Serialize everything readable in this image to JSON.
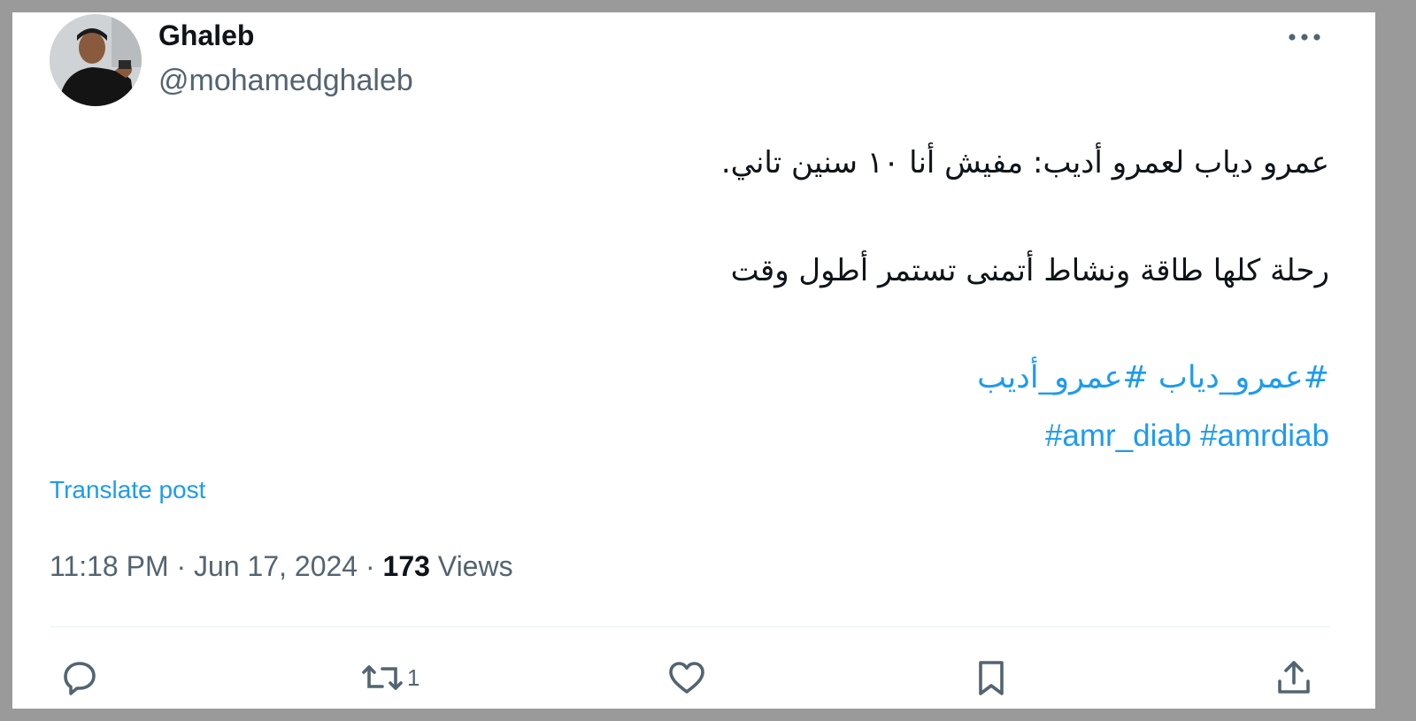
{
  "author": {
    "name": "Ghaleb",
    "handle": "@mohamedghaleb"
  },
  "post": {
    "line1": "عمرو دياب لعمرو أديب: مفيش أنا ١٠ سنين تاني.",
    "line2": "رحلة كلها طاقة ونشاط أتمنى تستمر أطول وقت",
    "hashtags_arabic": [
      "#عمرو_دياب",
      "#عمرو_أديب"
    ],
    "hashtags_latin": [
      "#amr_diab",
      "#amrdiab"
    ]
  },
  "translate_label": "Translate post",
  "meta": {
    "time": "11:18 PM",
    "separator": "·",
    "date": "Jun 17, 2024",
    "views_count": "173",
    "views_label": "Views"
  },
  "actions": {
    "retweet_count": "1"
  },
  "icons": [
    "more-icon",
    "reply-icon",
    "retweet-icon",
    "like-icon",
    "bookmark-icon",
    "share-icon"
  ],
  "colors": {
    "accent": "#1d9bf0",
    "text": "#0f1419",
    "secondary": "#536471"
  }
}
